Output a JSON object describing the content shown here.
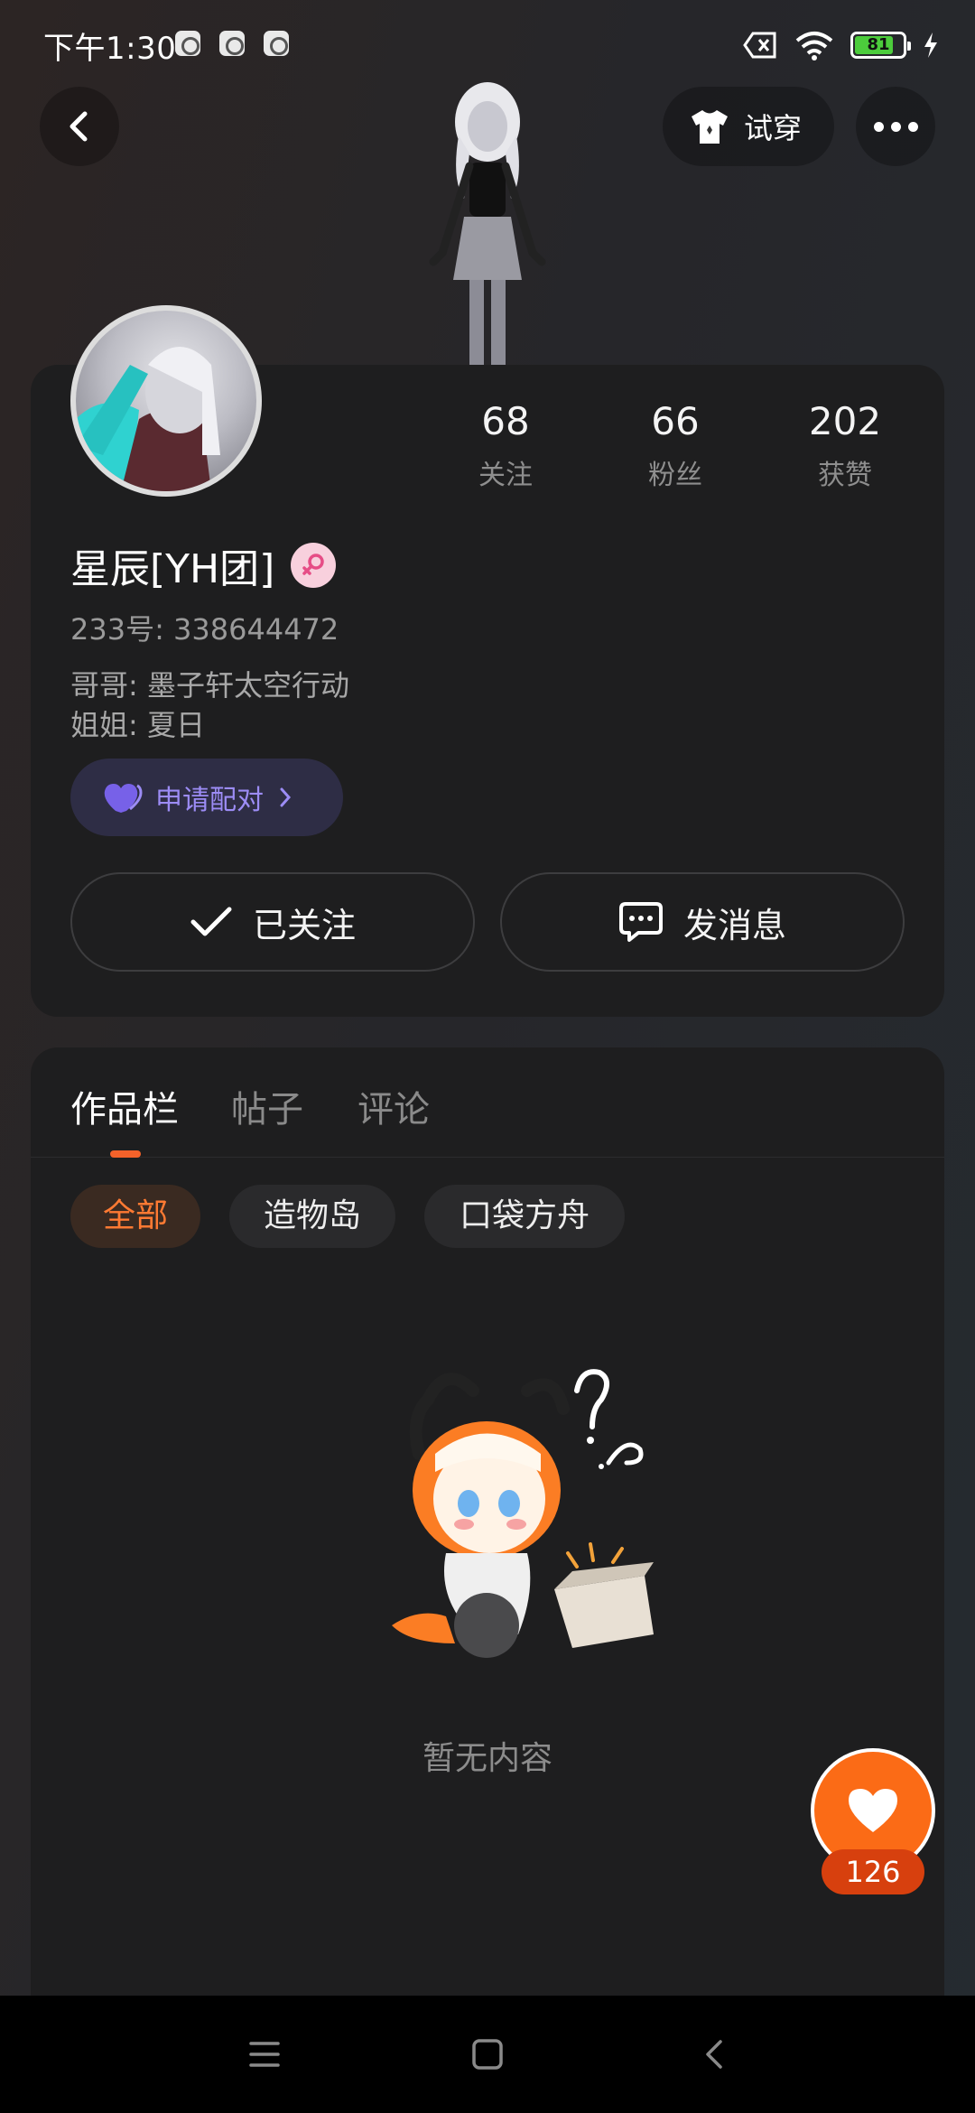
{
  "status_bar": {
    "time": "下午1:30",
    "battery": "81"
  },
  "header": {
    "tryon_label": "试穿"
  },
  "profile": {
    "stats": [
      {
        "value": "68",
        "label": "关注"
      },
      {
        "value": "66",
        "label": "粉丝"
      },
      {
        "value": "202",
        "label": "获赞"
      }
    ],
    "username": "星辰[YH团]",
    "account_id": "233号: 338644472",
    "relations": [
      "哥哥: 墨子轩太空行动",
      "姐姐: 夏日"
    ],
    "pair_label": "申请配对",
    "follow_label": "已关注",
    "message_label": "发消息"
  },
  "works": {
    "tabs": [
      {
        "label": "作品栏",
        "active": true
      },
      {
        "label": "帖子",
        "active": false
      },
      {
        "label": "评论",
        "active": false
      }
    ],
    "chips": [
      {
        "label": "全部",
        "active": true
      },
      {
        "label": "造物岛",
        "active": false
      },
      {
        "label": "口袋方舟",
        "active": false
      }
    ],
    "empty_text": "暂无内容"
  },
  "like": {
    "count": "126"
  },
  "colors": {
    "accent": "#fb6b16",
    "pair_text": "#9c8cf5",
    "card": "#1e1e1f"
  },
  "icons": [
    "back-icon",
    "shirt-icon",
    "more-icon",
    "check-icon",
    "chat-icon",
    "heart-icon",
    "menu-icon",
    "home-icon",
    "nav-back-icon"
  ]
}
